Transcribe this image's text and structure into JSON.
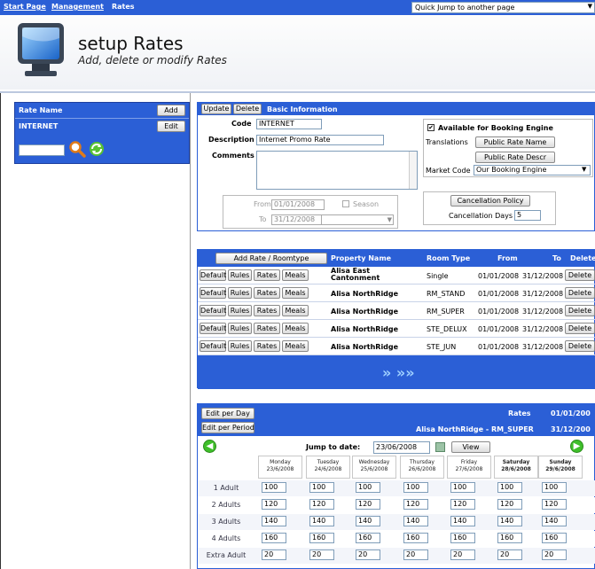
{
  "nav": {
    "start_page": "Start Page",
    "management": "Management",
    "rates": "Rates",
    "quick_jump": "Quick Jump to another page"
  },
  "header": {
    "title": "setup Rates",
    "subtitle": "Add, delete or modify Rates"
  },
  "left": {
    "column_header": "Rate Name",
    "add": "Add",
    "item": "INTERNET",
    "edit": "Edit"
  },
  "info": {
    "update": "Update",
    "delete": "Delete",
    "tab_title": "Basic Information",
    "code_label": "Code",
    "code_value": "INTERNET",
    "desc_label": "Description",
    "desc_value": "Internet Promo Rate",
    "comments_label": "Comments",
    "from_label": "From",
    "from_value": "01/01/2008",
    "to_label": "To",
    "to_value": "31/12/2008",
    "season_label": "Season",
    "available_label": "Available for Booking Engine",
    "translations_label": "Translations",
    "public_rate_name": "Public Rate Name",
    "public_rate_descr": "Public Rate Descr",
    "market_code_label": "Market Code",
    "market_code_value": "Our Booking Engine",
    "cancellation_policy": "Cancellation Policy",
    "cancellation_days_label": "Cancellation Days",
    "cancellation_days_value": "5"
  },
  "rate_list": {
    "add_button": "Add Rate / Roomtype",
    "headers": [
      "Property Name",
      "Room Type",
      "From",
      "To",
      "Delete"
    ],
    "row_buttons": [
      "Default",
      "Rules",
      "Rates",
      "Meals"
    ],
    "delete_label": "Delete",
    "rows": [
      {
        "property": "Alisa East Cantonment",
        "room_type": "Single",
        "from": "01/01/2008",
        "to": "31/12/2008"
      },
      {
        "property": "Alisa NorthRidge",
        "room_type": "RM_STAND",
        "from": "01/01/2008",
        "to": "31/12/2008"
      },
      {
        "property": "Alisa NorthRidge",
        "room_type": "RM_SUPER",
        "from": "01/01/2008",
        "to": "31/12/2008"
      },
      {
        "property": "Alisa NorthRidge",
        "room_type": "STE_DELUX",
        "from": "01/01/2008",
        "to": "31/12/2008"
      },
      {
        "property": "Alisa NorthRidge",
        "room_type": "STE_JUN",
        "from": "01/01/2008",
        "to": "31/12/2008"
      }
    ],
    "pager": "»  »»"
  },
  "grid": {
    "edit_per_day": "Edit per Day",
    "edit_per_period": "Edit per Period",
    "rates_label": "Rates",
    "date_from": "01/01/200",
    "date_to": "31/12/200",
    "subtitle": "Alisa NorthRidge - RM_SUPER",
    "jump_label": "Jump to date:",
    "jump_value": "23/06/2008",
    "view": "View",
    "days": [
      {
        "name": "Monday",
        "date": "23/6/2008"
      },
      {
        "name": "Tuesday",
        "date": "24/6/2008"
      },
      {
        "name": "Wednesday",
        "date": "25/6/2008"
      },
      {
        "name": "Thursday",
        "date": "26/6/2008"
      },
      {
        "name": "Friday",
        "date": "27/6/2008"
      },
      {
        "name": "Saturday",
        "date": "28/6/2008"
      },
      {
        "name": "Sunday",
        "date": "29/6/2008"
      }
    ],
    "rows": [
      {
        "label": "1 Adult",
        "values": [
          "100",
          "100",
          "100",
          "100",
          "100",
          "100",
          "100"
        ]
      },
      {
        "label": "2 Adults",
        "values": [
          "120",
          "120",
          "120",
          "120",
          "120",
          "120",
          "120"
        ]
      },
      {
        "label": "3 Adults",
        "values": [
          "140",
          "140",
          "140",
          "140",
          "140",
          "140",
          "140"
        ]
      },
      {
        "label": "4 Adults",
        "values": [
          "160",
          "160",
          "160",
          "160",
          "160",
          "160",
          "160"
        ]
      },
      {
        "label": "Extra Adult",
        "values": [
          "20",
          "20",
          "20",
          "20",
          "20",
          "20",
          "20"
        ]
      }
    ]
  }
}
